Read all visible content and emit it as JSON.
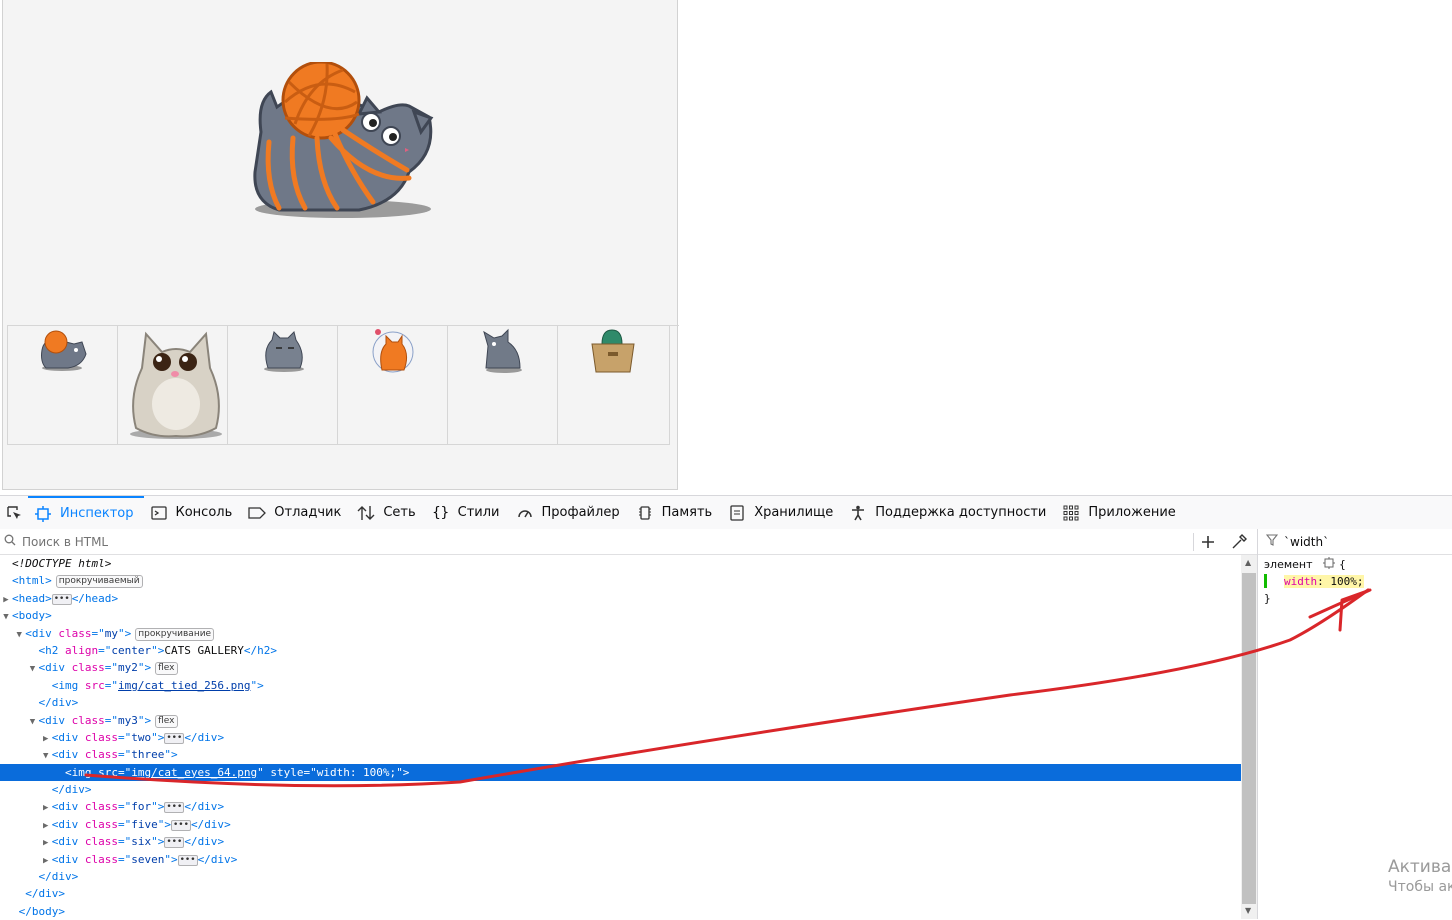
{
  "toolbar": {
    "tabs": [
      {
        "label": "Инспектор",
        "icon": "inspector-icon",
        "active": true
      },
      {
        "label": "Консоль",
        "icon": "console-icon"
      },
      {
        "label": "Отладчик",
        "icon": "debugger-icon"
      },
      {
        "label": "Сеть",
        "icon": "network-icon"
      },
      {
        "label": "Стили",
        "icon": "style-editor-icon"
      },
      {
        "label": "Профайлер",
        "icon": "profiler-icon"
      },
      {
        "label": "Память",
        "icon": "memory-icon"
      },
      {
        "label": "Хранилище",
        "icon": "storage-icon"
      },
      {
        "label": "Поддержка доступности",
        "icon": "accessibility-icon"
      },
      {
        "label": "Приложение",
        "icon": "application-icon"
      }
    ],
    "active_color": "#0a84ff"
  },
  "html_search": {
    "placeholder": "Поиск в HTML"
  },
  "tree": {
    "doctype": "<!DOCTYPE html>",
    "html_tag": "html",
    "html_badge": "прокручиваемый",
    "head_tag": "head",
    "body_tag": "body",
    "div_my": {
      "tag": "div",
      "attr": "class",
      "value": "my",
      "badge": "прокручивание"
    },
    "h2": {
      "tag": "h2",
      "attr": "align",
      "value": "center",
      "text": "CATS GALLERY"
    },
    "div_my2": {
      "tag": "div",
      "attr": "class",
      "value": "my2",
      "badge": "flex"
    },
    "img_tied": {
      "tag": "img",
      "attr": "src",
      "value": "img/cat_tied_256.png"
    },
    "div_my3": {
      "tag": "div",
      "attr": "class",
      "value": "my3",
      "badge": "flex"
    },
    "div_two": {
      "tag": "div",
      "attr": "class",
      "value": "two"
    },
    "div_three": {
      "tag": "div",
      "attr": "class",
      "value": "three"
    },
    "img_eyes": {
      "tag": "img",
      "attr": "src",
      "value": "img/cat_eyes_64.png",
      "attr2": "style",
      "value2": "width: 100%;"
    },
    "div_for": {
      "tag": "div",
      "attr": "class",
      "value": "for"
    },
    "div_five": {
      "tag": "div",
      "attr": "class",
      "value": "five"
    },
    "div_six": {
      "tag": "div",
      "attr": "class",
      "value": "six"
    },
    "div_seven": {
      "tag": "div",
      "attr": "class",
      "value": "seven"
    },
    "close_div": "</div>",
    "close_body": "</body>"
  },
  "rules": {
    "filter_text": "`width`",
    "selector": "элемент",
    "open_brace": "{",
    "close_brace": "}",
    "property": "width",
    "value": "100%;"
  },
  "watermark": {
    "line1": "Актива",
    "line2": "Чтобы ак"
  },
  "colors": {
    "selection": "#0a6cdb",
    "annotation_arrow": "#d9262a",
    "yarn": "#f07a22",
    "cat_gray": "#707a8a"
  }
}
